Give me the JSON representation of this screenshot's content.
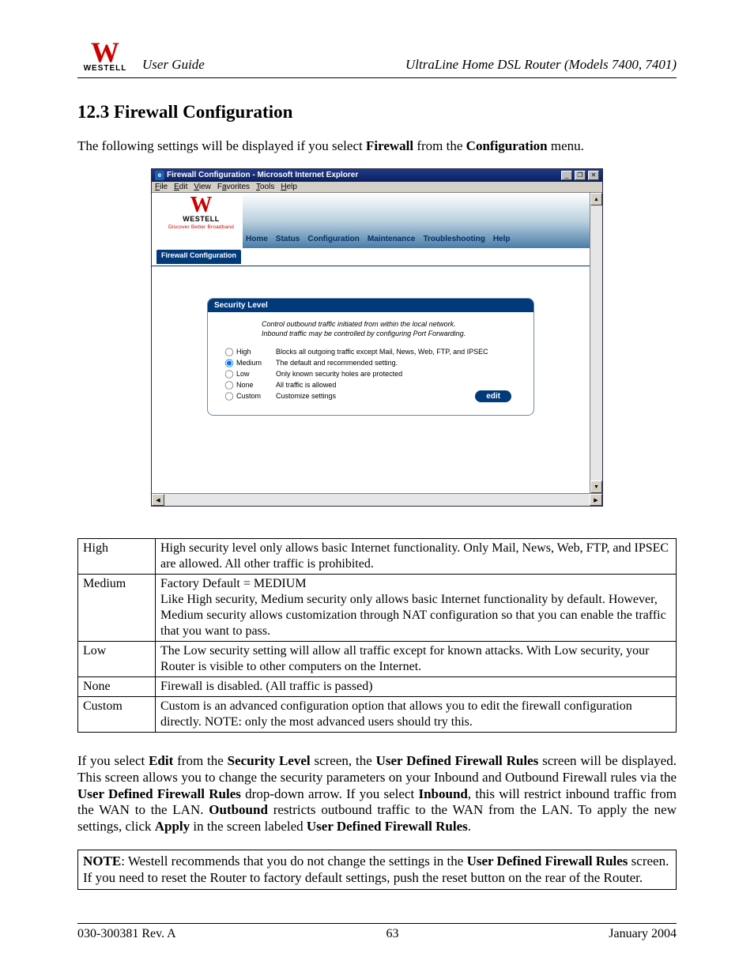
{
  "header": {
    "logo_name": "WESTELL",
    "guide": "User Guide",
    "product": "UltraLine Home DSL Router (Models 7400, 7401)"
  },
  "section": {
    "title": "12.3  Firewall Configuration",
    "intro_a": "The following settings will be displayed if you select ",
    "intro_b": "Firewall",
    "intro_c": " from the ",
    "intro_d": "Configuration",
    "intro_e": " menu."
  },
  "screenshot": {
    "title": "Firewall Configuration - Microsoft Internet Explorer",
    "menu": {
      "file": "File",
      "edit": "Edit",
      "view": "View",
      "favorites": "Favorites",
      "tools": "Tools",
      "help": "Help"
    },
    "logo_name": "WESTELL",
    "logo_tag": "Discover Better Broadband",
    "nav": [
      "Home",
      "Status",
      "Configuration",
      "Maintenance",
      "Troubleshooting",
      "Help"
    ],
    "active_tab": "Firewall Configuration",
    "panel_title": "Security Level",
    "panel_desc_1": "Control outbound traffic initiated from within the local network.",
    "panel_desc_2": "Inbound traffic may be controlled by configuring Port Forwarding.",
    "options": [
      {
        "label": "High",
        "desc": "Blocks all outgoing traffic except Mail, News, Web, FTP, and IPSEC",
        "checked": false
      },
      {
        "label": "Medium",
        "desc": "The default and recommended setting.",
        "checked": true
      },
      {
        "label": "Low",
        "desc": "Only known security holes are protected",
        "checked": false
      },
      {
        "label": "None",
        "desc": "All traffic is allowed",
        "checked": false
      },
      {
        "label": "Custom",
        "desc": "Customize settings",
        "checked": false
      }
    ],
    "edit_btn": "edit"
  },
  "defs": [
    {
      "k": "High",
      "v": "High security level only allows basic Internet functionality. Only Mail, News, Web, FTP, and IPSEC are allowed. All other traffic is prohibited. "
    },
    {
      "k": "Medium",
      "v": "Factory Default = MEDIUM\nLike High security, Medium security only allows basic Internet functionality by default. However, Medium security allows customization through NAT configuration so that you can enable the traffic that you want to pass."
    },
    {
      "k": "Low",
      "v": "The Low security setting will allow all traffic except for known attacks. With Low security, your Router is visible to other computers on the Internet."
    },
    {
      "k": "None",
      "v": "Firewall is disabled. (All traffic is passed)"
    },
    {
      "k": "Custom",
      "v": "Custom is an advanced configuration option that allows you to edit the firewall configuration directly. NOTE: only the most advanced users should try this."
    }
  ],
  "para": {
    "t1": "If you select ",
    "b1": "Edit",
    "t2": " from the ",
    "b2": "Security Level",
    "t3": " screen, the ",
    "b3": "User Defined Firewall Rules",
    "t4": " screen will be displayed. This screen allows you to change the security parameters on your Inbound and Outbound Firewall rules via the ",
    "b4": "User Defined Firewall Rules",
    "t5": " drop-down arrow. If you select ",
    "b5": "Inbound",
    "t6": ", this will restrict inbound traffic from the WAN to the LAN. ",
    "b6": "Outbound",
    "t7": " restricts outbound traffic to the WAN from the LAN. To apply the new settings, click ",
    "b7": "Apply",
    "t8": " in the screen labeled ",
    "b8": "User Defined Firewall Rules",
    "t9": "."
  },
  "note": {
    "b1": "NOTE",
    "t1": ": Westell recommends that you do not change the settings in the ",
    "b2": "User Defined Firewall Rules",
    "t2": " screen. If you need to reset the Router to factory default settings, push the reset button on the rear of the Router."
  },
  "footer": {
    "rev": "030-300381 Rev. A",
    "page": "63",
    "date": "January 2004"
  }
}
